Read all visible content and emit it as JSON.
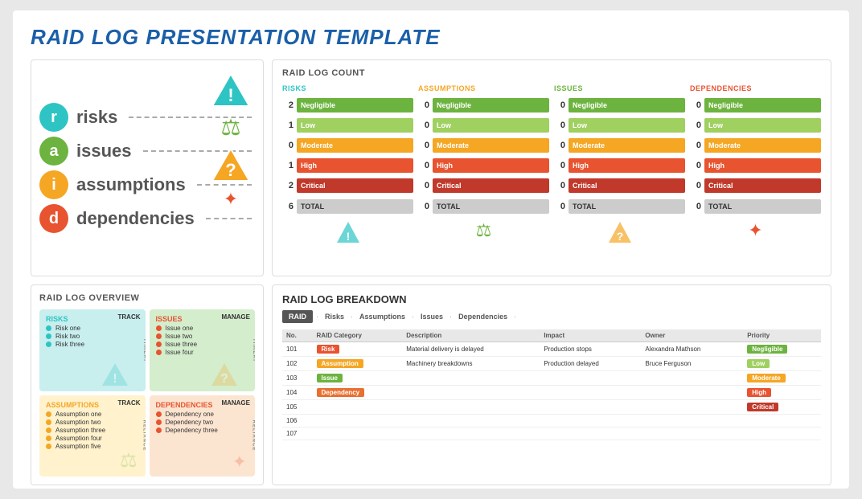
{
  "page": {
    "title": "RAID LOG PRESENTATION TEMPLATE"
  },
  "raid_acronym": {
    "items": [
      {
        "letter": "r",
        "word": "risks",
        "color": "#2ec4c4"
      },
      {
        "letter": "a",
        "word": "issues",
        "color": "#6db33f"
      },
      {
        "letter": "i",
        "word": "assumptions",
        "color": "#f5a623"
      },
      {
        "letter": "d",
        "word": "dependencies",
        "color": "#e85330"
      }
    ]
  },
  "raid_count": {
    "title": "RAID LOG COUNT",
    "columns": [
      {
        "name": "RISKS",
        "color": "#2ec4c4",
        "rows": [
          {
            "count": "2",
            "label": "Negligible",
            "color": "#6db33f"
          },
          {
            "count": "1",
            "label": "Low",
            "color": "#a0d060"
          },
          {
            "count": "0",
            "label": "Moderate",
            "color": "#f5a623"
          },
          {
            "count": "1",
            "label": "High",
            "color": "#e85330"
          },
          {
            "count": "2",
            "label": "Critical",
            "color": "#c0392b"
          }
        ],
        "total": "6"
      },
      {
        "name": "ASSUMPTIONS",
        "color": "#f5a623",
        "rows": [
          {
            "count": "0",
            "label": "Negligible",
            "color": "#6db33f"
          },
          {
            "count": "0",
            "label": "Low",
            "color": "#a0d060"
          },
          {
            "count": "0",
            "label": "Moderate",
            "color": "#f5a623"
          },
          {
            "count": "0",
            "label": "High",
            "color": "#e85330"
          },
          {
            "count": "0",
            "label": "Critical",
            "color": "#c0392b"
          }
        ],
        "total": "0"
      },
      {
        "name": "ISSUES",
        "color": "#6db33f",
        "rows": [
          {
            "count": "0",
            "label": "Negligible",
            "color": "#6db33f"
          },
          {
            "count": "0",
            "label": "Low",
            "color": "#a0d060"
          },
          {
            "count": "0",
            "label": "Moderate",
            "color": "#f5a623"
          },
          {
            "count": "0",
            "label": "High",
            "color": "#e85330"
          },
          {
            "count": "0",
            "label": "Critical",
            "color": "#c0392b"
          }
        ],
        "total": "0"
      },
      {
        "name": "DEPENDENCIES",
        "color": "#e85330",
        "rows": [
          {
            "count": "0",
            "label": "Negligible",
            "color": "#6db33f"
          },
          {
            "count": "0",
            "label": "Low",
            "color": "#a0d060"
          },
          {
            "count": "0",
            "label": "Moderate",
            "color": "#f5a623"
          },
          {
            "count": "0",
            "label": "High",
            "color": "#e85330"
          },
          {
            "count": "0",
            "label": "Critical",
            "color": "#c0392b"
          }
        ],
        "total": "0"
      }
    ]
  },
  "raid_overview": {
    "title": "RAID LOG OVERVIEW",
    "cells": [
      {
        "title": "RISKS",
        "action": "TRACK",
        "color": "#c8eeee",
        "dotColor": "#2ec4c4",
        "items": [
          "Risk one",
          "Risk two",
          "Risk three"
        ]
      },
      {
        "title": "ISSUES",
        "action": "MANAGE",
        "color": "#d4edcc",
        "dotColor": "#f5a623",
        "items": [
          "Issue one",
          "Issue two",
          "Issue three",
          "Issue four"
        ]
      },
      {
        "title": "ASSUMPTIONS",
        "action": "TRACK",
        "color": "#fff2cc",
        "dotColor": "#6db33f",
        "items": [
          "Assumption one",
          "Assumption two",
          "Assumption three",
          "Assumption four",
          "Assumption five"
        ]
      },
      {
        "title": "DEPENDENCIES",
        "action": "MANAGE",
        "color": "#fce5d0",
        "dotColor": "#e85330",
        "items": [
          "Dependency one",
          "Dependency two",
          "Dependency three"
        ]
      }
    ]
  },
  "raid_breakdown": {
    "title": "RAID LOG BREAKDOWN",
    "tabs": [
      "RAID",
      "Risks",
      "Assumptions",
      "Issues",
      "Dependencies"
    ],
    "active_tab": "RAID",
    "columns": [
      "No.",
      "RAID Category",
      "Description",
      "Impact",
      "Owner",
      "Priority"
    ],
    "rows": [
      {
        "no": "101",
        "category": "Risk",
        "category_color": "#e85330",
        "description": "Material delivery is delayed",
        "impact": "Production stops",
        "owner": "Alexandra Mathson",
        "priority": "Negligible",
        "priority_color": "#6db33f"
      },
      {
        "no": "102",
        "category": "Assumption",
        "category_color": "#f5a623",
        "description": "Machinery breakdowns",
        "impact": "Production delayed",
        "owner": "Bruce Ferguson",
        "priority": "Low",
        "priority_color": "#a0d060"
      },
      {
        "no": "103",
        "category": "Issue",
        "category_color": "#6db33f",
        "description": "",
        "impact": "",
        "owner": "",
        "priority": "Moderate",
        "priority_color": "#f5a623"
      },
      {
        "no": "104",
        "category": "Dependency",
        "category_color": "#e87030",
        "description": "",
        "impact": "",
        "owner": "",
        "priority": "High",
        "priority_color": "#e85330"
      },
      {
        "no": "105",
        "category": "",
        "category_color": "",
        "description": "",
        "impact": "",
        "owner": "",
        "priority": "Critical",
        "priority_color": "#c0392b"
      },
      {
        "no": "106",
        "category": "",
        "category_color": "",
        "description": "",
        "impact": "",
        "owner": "",
        "priority": "",
        "priority_color": ""
      },
      {
        "no": "107",
        "category": "",
        "category_color": "",
        "description": "",
        "impact": "",
        "owner": "",
        "priority": "",
        "priority_color": ""
      }
    ]
  }
}
